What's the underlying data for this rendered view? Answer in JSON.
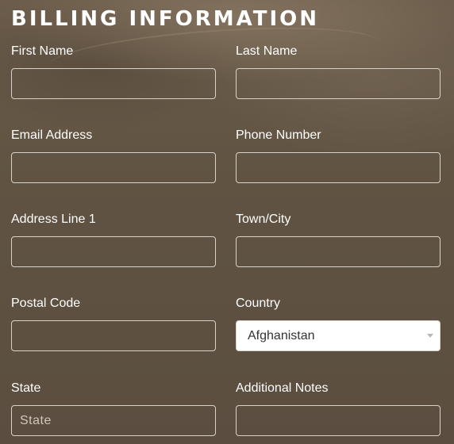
{
  "form": {
    "title": "BILLING INFORMATION",
    "fields": {
      "first_name": {
        "label": "First Name",
        "value": ""
      },
      "last_name": {
        "label": "Last Name",
        "value": ""
      },
      "email": {
        "label": "Email Address",
        "value": ""
      },
      "phone": {
        "label": "Phone Number",
        "value": ""
      },
      "address1": {
        "label": "Address Line 1",
        "value": ""
      },
      "town": {
        "label": "Town/City",
        "value": ""
      },
      "postal": {
        "label": "Postal Code",
        "value": ""
      },
      "country": {
        "label": "Country",
        "selected": "Afghanistan",
        "icon": "chevron-down-icon"
      },
      "state": {
        "label": "State",
        "value": "",
        "placeholder": "State"
      },
      "notes": {
        "label": "Additional Notes",
        "value": ""
      }
    }
  }
}
